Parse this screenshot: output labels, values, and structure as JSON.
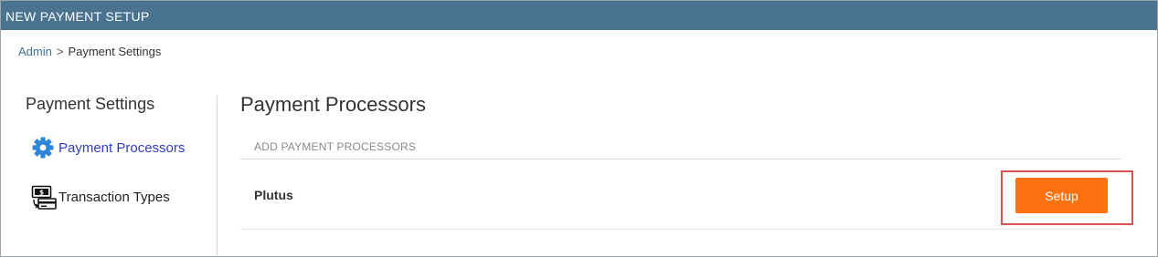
{
  "window": {
    "title": "NEW PAYMENT SETUP"
  },
  "breadcrumb": {
    "parent": "Admin",
    "separator": ">",
    "current": "Payment Settings"
  },
  "sidebar": {
    "title": "Payment Settings",
    "items": [
      {
        "label": "Payment Processors",
        "icon": "gear-icon",
        "active": true
      },
      {
        "label": "Transaction Types",
        "icon": "transaction-icon",
        "active": false
      }
    ]
  },
  "main": {
    "title": "Payment Processors",
    "subheader": "ADD PAYMENT PROCESSORS",
    "rows": [
      {
        "name": "Plutus",
        "action_label": "Setup"
      }
    ]
  },
  "colors": {
    "titlebar": "#4a7390",
    "active_link": "#2f3cc4",
    "button": "#fd7110",
    "highlight_border": "#d9534f"
  }
}
